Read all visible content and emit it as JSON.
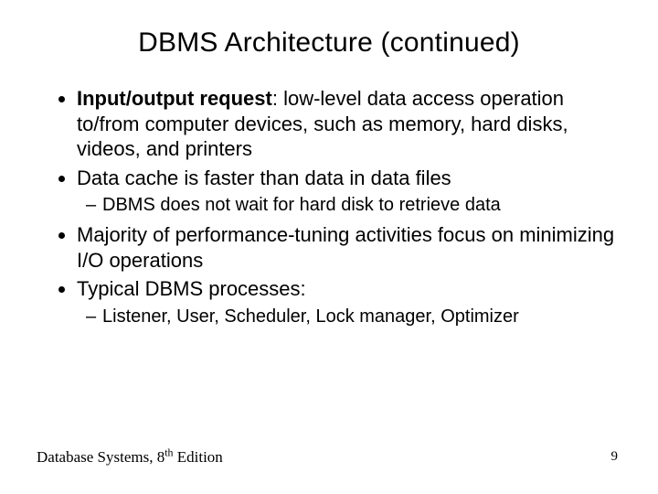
{
  "title": "DBMS Architecture (continued)",
  "bullets": {
    "b1_bold": "Input/output request",
    "b1_rest": ": low-level data access operation to/from computer devices, such as memory, hard disks, videos, and printers",
    "b2": "Data cache is faster than data in data files",
    "b2_sub": "DBMS does not wait for hard disk to retrieve data",
    "b3": "Majority of performance-tuning activities focus on minimizing I/O operations",
    "b4": "Typical DBMS processes:",
    "b4_sub": "Listener, User, Scheduler, Lock manager, Optimizer"
  },
  "footer": {
    "book_prefix": "Database Systems, 8",
    "book_sup": "th",
    "book_suffix": " Edition",
    "page": "9"
  }
}
